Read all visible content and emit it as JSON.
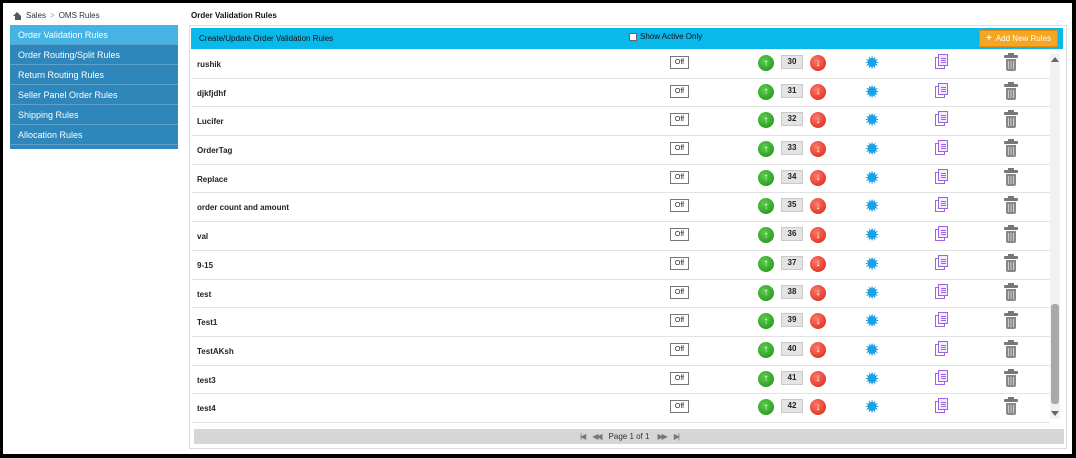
{
  "breadcrumb": {
    "home": "Sales",
    "current": "OMS Rules"
  },
  "sidebar": {
    "items": [
      {
        "label": "Order Validation Rules"
      },
      {
        "label": "Order Routing/Split Rules"
      },
      {
        "label": "Return Routing Rules"
      },
      {
        "label": "Seller Panel Order Rules"
      },
      {
        "label": "Shipping Rules"
      },
      {
        "label": "Allocation Rules"
      }
    ]
  },
  "main": {
    "title": "Order Validation Rules",
    "header_title": "Create/Update Order Validation Rules",
    "show_active_label": "Show Active Only",
    "add_button_label": "Add New Rules",
    "add_button_icon": "+"
  },
  "rows": [
    {
      "name": "rushik",
      "status": "Off",
      "order": "30"
    },
    {
      "name": "djkfjdhf",
      "status": "Off",
      "order": "31"
    },
    {
      "name": "Lucifer",
      "status": "Off",
      "order": "32"
    },
    {
      "name": "OrderTag",
      "status": "Off",
      "order": "33"
    },
    {
      "name": "Replace",
      "status": "Off",
      "order": "34"
    },
    {
      "name": "order count and amount",
      "status": "Off",
      "order": "35"
    },
    {
      "name": "val",
      "status": "Off",
      "order": "36"
    },
    {
      "name": "9-15",
      "status": "Off",
      "order": "37"
    },
    {
      "name": "test",
      "status": "Off",
      "order": "38"
    },
    {
      "name": "Test1",
      "status": "Off",
      "order": "39"
    },
    {
      "name": "TestAKsh",
      "status": "Off",
      "order": "40"
    },
    {
      "name": "test3",
      "status": "Off",
      "order": "41"
    },
    {
      "name": "test4",
      "status": "Off",
      "order": "42"
    }
  ],
  "pager": {
    "label": "Page 1 of 1"
  },
  "icons": {
    "home": "home-icon",
    "up": "arrow-up-icon",
    "down": "arrow-down-icon",
    "gear": "gear-icon",
    "copy": "copy-icon",
    "trash": "trash-icon"
  },
  "colors": {
    "accent": "#0ab8ea",
    "sidebar": "#2e86ba",
    "add_button": "#f5a623"
  }
}
